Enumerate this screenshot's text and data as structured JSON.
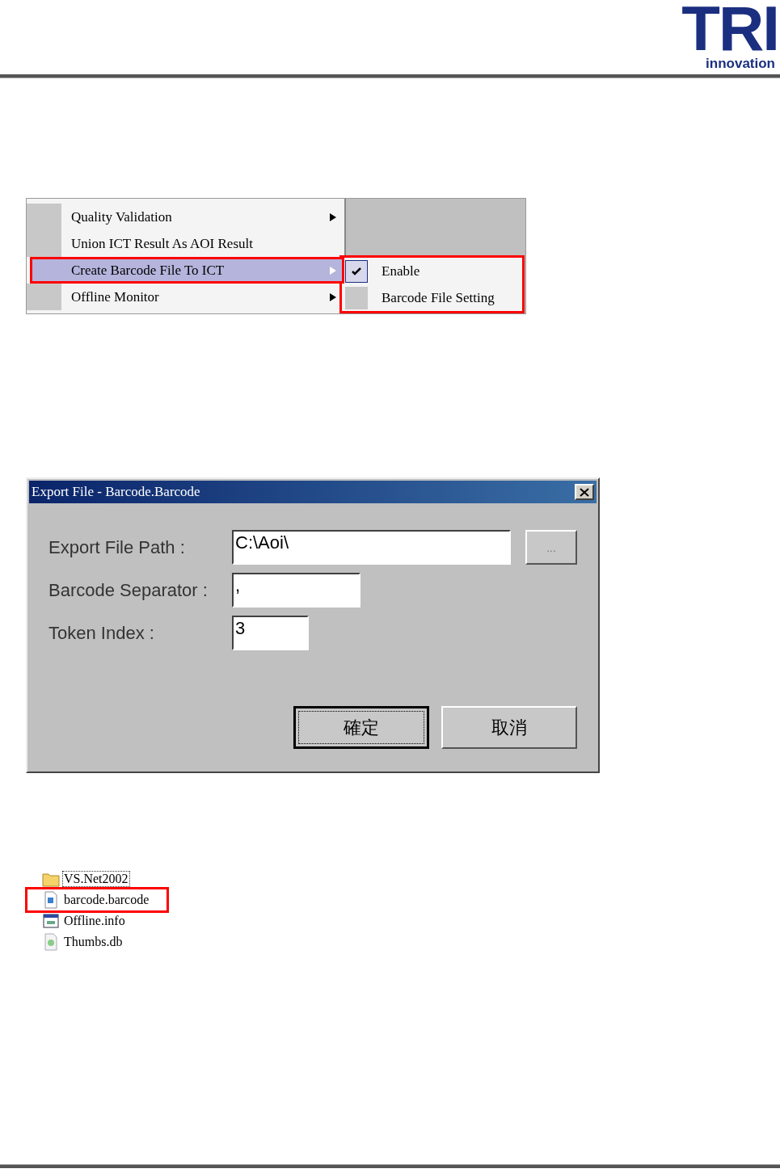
{
  "logo": {
    "mark": "TRI",
    "tagline": "innovation"
  },
  "context_menu": {
    "items": [
      {
        "label": "Quality Validation",
        "submenu": true,
        "selected": false,
        "highlighted": false
      },
      {
        "label": "Union ICT Result As AOI Result",
        "submenu": false,
        "selected": false,
        "highlighted": false
      },
      {
        "label": "Create Barcode File To ICT",
        "submenu": true,
        "selected": true,
        "highlighted": true
      },
      {
        "label": "Offline Monitor",
        "submenu": true,
        "selected": false,
        "highlighted": false
      }
    ]
  },
  "submenu": {
    "highlighted": true,
    "items": [
      {
        "label": "Enable",
        "checked": true
      },
      {
        "label": "Barcode File Setting",
        "checked": false
      }
    ]
  },
  "dialog": {
    "title": "Export File - Barcode.Barcode",
    "fields": [
      {
        "kind": "path",
        "label": "Export File Path :",
        "value": "C:\\Aoi\\"
      },
      {
        "kind": "text",
        "label": "Barcode Separator :",
        "value": ","
      },
      {
        "kind": "number",
        "label": "Token Index :",
        "value": "3"
      }
    ],
    "browse_button": "...",
    "buttons": [
      {
        "label": "確定",
        "focused": true
      },
      {
        "label": "取消",
        "focused": false
      }
    ]
  },
  "file_list": {
    "items": [
      {
        "kind": "folder",
        "name": "VS.Net2002",
        "selected": true,
        "highlighted": false
      },
      {
        "kind": "document",
        "name": "barcode.barcode",
        "selected": false,
        "highlighted": true
      },
      {
        "kind": "window",
        "name": "Offline.info",
        "selected": false,
        "highlighted": false
      },
      {
        "kind": "database",
        "name": "Thumbs.db",
        "selected": false,
        "highlighted": false
      }
    ]
  }
}
